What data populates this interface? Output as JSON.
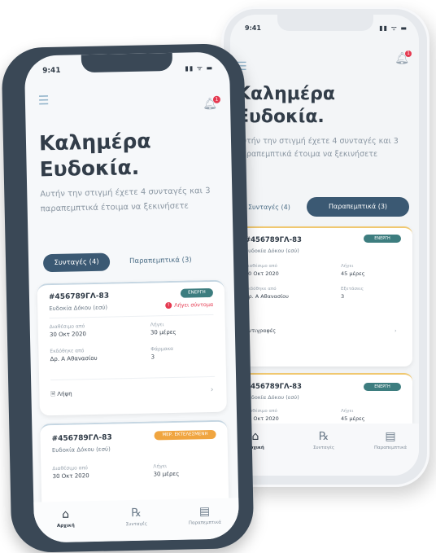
{
  "status": {
    "time": "9:41",
    "icons": "signal-wifi-battery"
  },
  "header": {
    "menu_icon": "menu-icon",
    "bell_icon": "bell-icon",
    "notification_count": "1"
  },
  "greeting": {
    "line1": "Καλημέρα",
    "line2": "Ευδοκία."
  },
  "subtitle": "Αυτήν την στιγμή έχετε 4 συνταγές και 3 παραπεμπτικά έτοιμα να ξεκινήσετε",
  "tabs": {
    "prescriptions": "Συνταγές (4)",
    "referrals": "Παραπεμπτικά (3)"
  },
  "front_cards": [
    {
      "id": "#456789ΓΛ-83",
      "patient": "Ευδοκία Δόκου (εσύ)",
      "badge": "ΕΝΕΡΓΗ",
      "badge_color": "#3d7d7f",
      "warning": "Λήγει σύντομα",
      "issued_label": "Διαθέσιμο από",
      "issued_value": "30 Οκτ 2020",
      "expires_label": "Λήγει",
      "expires_value": "30 μέρες",
      "doctor_label": "Εκδόθηκε από",
      "doctor_value": "Δρ. Α Αθανασίου",
      "drugs_label": "Φάρμακα",
      "drugs_value": "3",
      "action": "Λήψη"
    },
    {
      "id": "#456789ΓΛ-83",
      "patient": "Ευδοκία Δόκου (εσύ)",
      "badge": "ΜΕΡ. ΕΚΤΕΛΕΣΜΕΝΗ",
      "badge_color": "#f0a540",
      "issued_label": "Διαθέσιμο από",
      "issued_value": "30 Οκτ 2020",
      "expires_label": "Λήγει",
      "expires_value": "30 μέρες"
    }
  ],
  "back_cards": [
    {
      "id": "#456789ΓΛ-83",
      "patient": "Ευδοκία Δόκου (εσύ)",
      "badge": "ΕΝΕΡΓΗ",
      "issued_label": "Διαθέσιμο από",
      "issued_value": "30 Οκτ 2020",
      "expires_label": "Λήγει",
      "expires_value": "45 μέρες",
      "doctor_label": "Εκδόθηκε από",
      "doctor_value": "Δρ. Α Αθανασίου",
      "exams_label": "Εξετάσεις",
      "exams_value": "3",
      "action": "Αντιγραφές"
    },
    {
      "id": "#456789ΓΛ-83",
      "patient": "Ευδοκία Δόκου (εσύ)",
      "badge": "ΕΝΕΡΓΗ",
      "issued_label": "Διαθέσιμο από",
      "issued_value": "30 Οκτ 2020",
      "expires_label": "Λήγει",
      "expires_value": "45 μέρες"
    }
  ],
  "nav": {
    "home": "Αρχική",
    "prescriptions": "Συνταγές",
    "referrals": "Παραπεμπτικά"
  },
  "colors": {
    "primary": "#3b5973",
    "active_badge": "#3d7d7f",
    "partial_badge": "#f0a540",
    "alert": "#e53950",
    "phone_dark": "#3a4856"
  }
}
